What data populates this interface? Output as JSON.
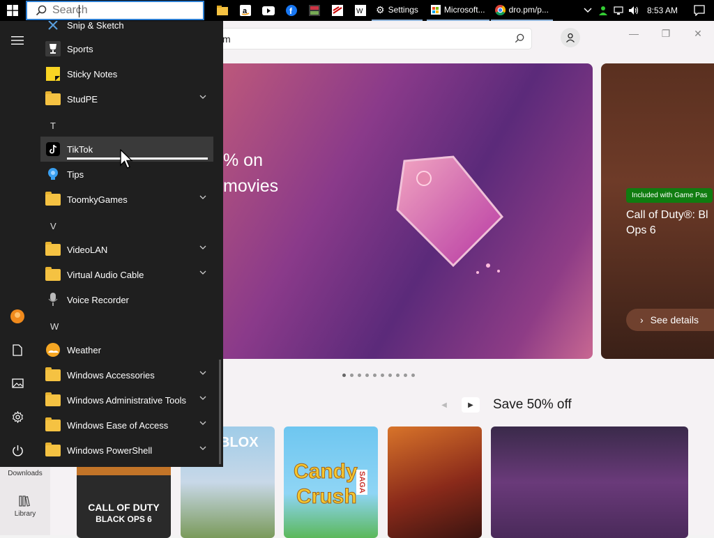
{
  "taskbar": {
    "search_placeholder": "Search",
    "settings_label": "Settings",
    "store_window_label": "Microsoft...",
    "chrome_window_label": "dro.pm/p...",
    "clock": "8:53 AM"
  },
  "store": {
    "search_value": "m",
    "hero_text_line1": "% on",
    "hero_text_line2": "movies",
    "badge": "Included with Game Pas",
    "cod_title": "Call of Duty®: Bl Ops 6",
    "see_details": "See details",
    "deals_heading": "Save 50% off",
    "nav_downloads": "Downloads",
    "nav_library": "Library",
    "tiles": {
      "cod_line1": "CALL OF DUTY",
      "cod_line2": "BLACK OPS 6",
      "roblox": "BLOX",
      "candy1": "Candy",
      "candy2": "Crush",
      "saga": "SAGA"
    }
  },
  "start_menu": {
    "rows": [
      {
        "label": "Snip & Sketch"
      },
      {
        "label": "Sports"
      },
      {
        "label": "Sticky Notes"
      },
      {
        "label": "StudPE"
      },
      {
        "letter": "T"
      },
      {
        "label": "TikTok"
      },
      {
        "label": "Tips"
      },
      {
        "label": "ToomkyGames"
      },
      {
        "letter": "V"
      },
      {
        "label": "VideoLAN"
      },
      {
        "label": "Virtual Audio Cable"
      },
      {
        "label": "Voice Recorder"
      },
      {
        "letter": "W"
      },
      {
        "label": "Weather"
      },
      {
        "label": "Windows Accessories"
      },
      {
        "label": "Windows Administrative Tools"
      },
      {
        "label": "Windows Ease of Access"
      },
      {
        "label": "Windows PowerShell"
      }
    ],
    "tiktok_install_progress": 1.0
  },
  "colors": {
    "taskbar": "#000000",
    "start_bg": "#1f1f1f",
    "folder": "#f5c242",
    "search_border": "#2d7fd3",
    "gamepass_green": "#107c10"
  }
}
